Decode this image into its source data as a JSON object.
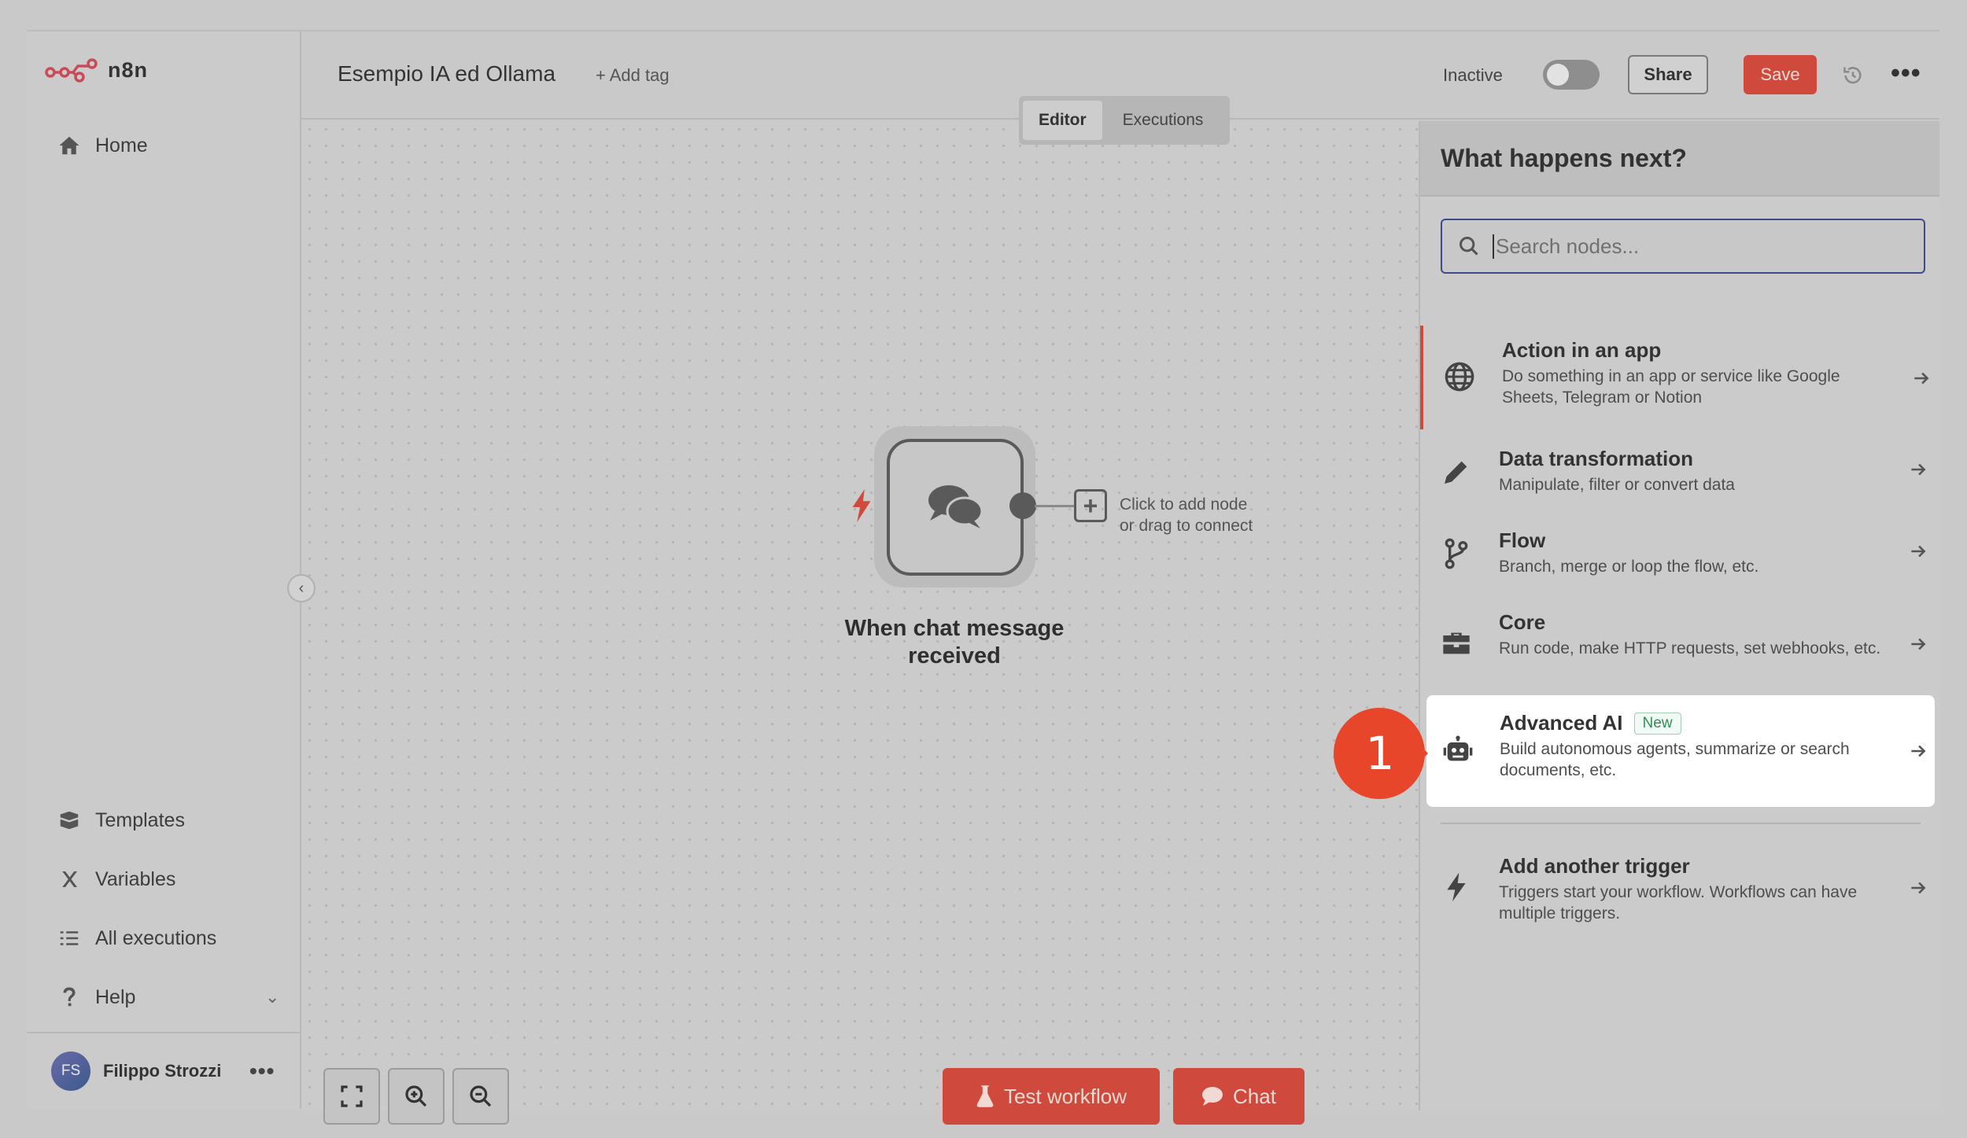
{
  "app": {
    "logo_text": "n8n"
  },
  "sidebar": {
    "items": [
      {
        "label": "Home",
        "icon": "home-icon"
      },
      {
        "label": "Templates",
        "icon": "templates-icon"
      },
      {
        "label": "Variables",
        "icon": "variables-icon"
      },
      {
        "label": "All executions",
        "icon": "executions-list-icon"
      },
      {
        "label": "Help",
        "icon": "help-icon"
      }
    ],
    "user": {
      "initials": "FS",
      "name": "Filippo Strozzi",
      "more": "•••"
    }
  },
  "header": {
    "workflow_title": "Esempio IA ed Ollama",
    "add_tag": "+ Add tag",
    "status_label": "Inactive",
    "share_label": "Share",
    "save_label": "Save",
    "more": "•••",
    "tabs": [
      {
        "label": "Editor",
        "active": true
      },
      {
        "label": "Executions",
        "active": false
      }
    ]
  },
  "canvas": {
    "node_label": "When chat message received",
    "add_hint_line1": "Click to add node",
    "add_hint_line2": "or drag to connect",
    "test_workflow_label": "Test workflow",
    "chat_label": "Chat"
  },
  "panel": {
    "title": "What happens next?",
    "search_placeholder": "Search nodes...",
    "categories": [
      {
        "title": "Action in an app",
        "desc": "Do something in an app or service like Google Sheets, Telegram or Notion",
        "icon": "globe-icon"
      },
      {
        "title": "Data transformation",
        "desc": "Manipulate, filter or convert data",
        "icon": "pen-icon"
      },
      {
        "title": "Flow",
        "desc": "Branch, merge or loop the flow, etc.",
        "icon": "branch-icon"
      },
      {
        "title": "Core",
        "desc": "Run code, make HTTP requests, set webhooks, etc.",
        "icon": "toolbox-icon"
      },
      {
        "title": "Advanced AI",
        "badge": "New",
        "desc": "Build autonomous agents, summarize or search documents, etc.",
        "icon": "robot-icon"
      },
      {
        "title": "Add another trigger",
        "desc": "Triggers start your workflow. Workflows can have multiple triggers.",
        "icon": "bolt-icon"
      }
    ]
  },
  "annotation": {
    "step_number": "1"
  },
  "colors": {
    "accent": "#cf4a3c",
    "badge_green": "#2f8f55",
    "focus_border": "#3f4a8c"
  }
}
